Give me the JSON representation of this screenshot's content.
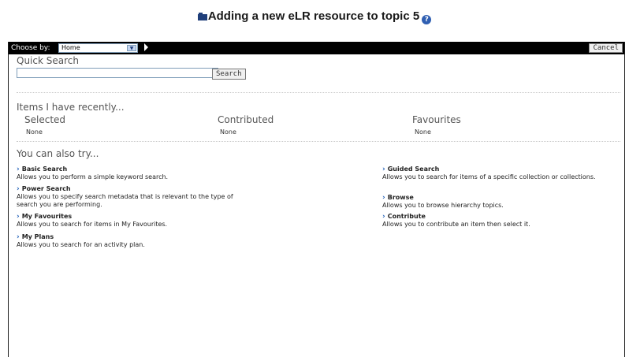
{
  "page": {
    "title": "Adding a new eLR resource to topic 5",
    "help_icon": "?"
  },
  "toolbar": {
    "choose_label": "Choose by:",
    "choose_value": "Home",
    "cancel_label": "Cancel"
  },
  "quick_search": {
    "heading": "Quick Search",
    "input_value": "",
    "button_label": "Search"
  },
  "recent": {
    "heading": "Items I have recently...",
    "columns": [
      {
        "label": "Selected",
        "value": "None"
      },
      {
        "label": "Contributed",
        "value": "None"
      },
      {
        "label": "Favourites",
        "value": "None"
      }
    ]
  },
  "try": {
    "heading": "You can also try...",
    "left": [
      {
        "title": "Basic Search",
        "desc": "Allows you to perform a simple keyword search."
      },
      {
        "title": "Power Search",
        "desc": "Allows you to specify search metadata that is relevant to the type of search you are performing."
      },
      {
        "title": "My Favourites",
        "desc": "Allows you to search for items in My Favourites."
      },
      {
        "title": "My Plans",
        "desc": "Allows you to search for an activity plan."
      }
    ],
    "right": [
      {
        "title": "Guided Search",
        "desc": "Allows you to search for items of a specific collection or collections."
      },
      {
        "title": "Browse",
        "desc": "Allows you to browse hierarchy topics."
      },
      {
        "title": "Contribute",
        "desc": "Allows you to contribute an item then select it."
      }
    ]
  },
  "icons": {
    "title": "folder-icon",
    "help": "help-icon",
    "go": "play-arrow-icon",
    "link": "chevron-right-icon"
  },
  "colors": {
    "toolbar_bg": "#000000",
    "link_chevron": "#1f5fb8",
    "heading_text": "#555555"
  }
}
